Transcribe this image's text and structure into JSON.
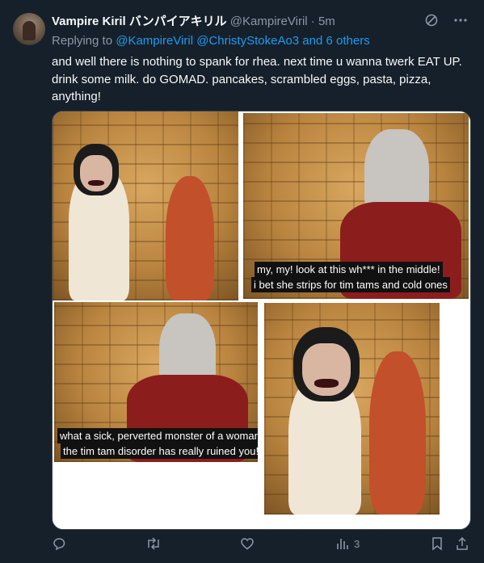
{
  "tweet": {
    "display_name": "Vampire Kiril バンパイアキリル",
    "handle": "@KampireViril",
    "separator": "·",
    "time": "5m",
    "replying_prefix": "Replying to",
    "replying_users": "@KampireViril @ChristyStokeAo3 and 6 others",
    "text": "and well there is nothing to spank for rhea. next time u wanna twerk EAT UP. drink some milk. do GOMAD. pancakes, scrambled eggs, pasta, pizza, anything!"
  },
  "media": {
    "captions": {
      "panel2_line1": "my, my! look at this wh*** in the middle!",
      "panel2_line2": "i bet she strips for tim tams and cold ones",
      "panel3_line1": "what a sick, perverted monster of a woman!",
      "panel3_line2": "the tim tam disorder has really ruined you!"
    }
  },
  "actions": {
    "views_count": "3"
  },
  "colors": {
    "background": "#15202b",
    "text": "#f7f9f9",
    "secondary": "#8b98a5",
    "link": "#1d9bf0",
    "border": "#38444d"
  },
  "icons": [
    "grok-icon",
    "more-icon",
    "reply-icon",
    "retweet-icon",
    "like-icon",
    "views-icon",
    "bookmark-icon",
    "share-icon"
  ]
}
